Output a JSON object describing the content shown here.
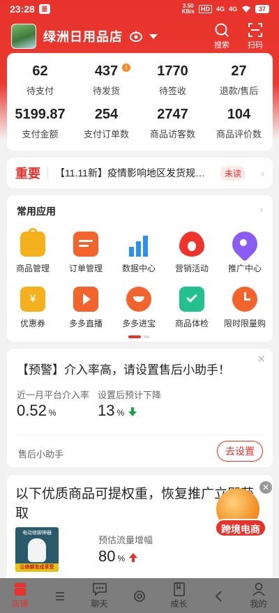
{
  "status_bar": {
    "time": "23:28",
    "app_badge": "鉴",
    "net_speed": "3.50",
    "net_unit": "KB/s",
    "hd": "HD",
    "sig1": "4G",
    "sig2": "4G",
    "battery": "37"
  },
  "header": {
    "shop_name": "绿洲日用品店",
    "search_label": "搜索",
    "scan_label": "扫码"
  },
  "stats": [
    {
      "value": "62",
      "label": "待支付"
    },
    {
      "value": "437",
      "label": "待发货",
      "badge": "!"
    },
    {
      "value": "1770",
      "label": "待签收"
    },
    {
      "value": "27",
      "label": "退款/售后"
    },
    {
      "value": "5199.87",
      "label": "支付金额"
    },
    {
      "value": "254",
      "label": "支付订单数"
    },
    {
      "value": "2747",
      "label": "商品访客数"
    },
    {
      "value": "104",
      "label": "商品评价数"
    }
  ],
  "notice": {
    "tag": "重要",
    "text": "【11.11新】疫情影响地区发货规…",
    "unread": "未读"
  },
  "apps": {
    "title": "常用应用",
    "items": [
      {
        "label": "商品管理",
        "color": "#f5b11d"
      },
      {
        "label": "订单管理",
        "color": "#f2642b"
      },
      {
        "label": "数据中心",
        "color": "#2f8ff0"
      },
      {
        "label": "营销活动",
        "color": "#f0342b"
      },
      {
        "label": "推广中心",
        "color": "#8a5cf5"
      },
      {
        "label": "优惠券",
        "color": "#f5b11d"
      },
      {
        "label": "多多直播",
        "color": "#f2642b"
      },
      {
        "label": "多多进宝",
        "color": "#f2642b"
      },
      {
        "label": "商品体检",
        "color": "#22c18d"
      },
      {
        "label": "限时限量购",
        "color": "#f2642b"
      }
    ]
  },
  "alert": {
    "title": "【预警】介入率高，请设置售后小助手！",
    "metric1_label": "近一月平台介入率",
    "metric1_value": "0.52",
    "metric1_unit": "%",
    "metric2_label": "设置后预计下降",
    "metric2_value": "13",
    "metric2_unit": "%",
    "footer": "售后小助手",
    "button": "去设置"
  },
  "promo": {
    "title": "以下优质商品可提权重，恢复推广立即获取",
    "product_caption": "电动修脚神器",
    "product_band": "让修脚变成享受",
    "metric_label": "预估流量增幅",
    "metric_value": "80",
    "metric_unit": "%"
  },
  "float_badge": {
    "label": "跨境电商"
  },
  "tabbar": [
    {
      "label": "店铺",
      "icon": "shop-icon",
      "active": true
    },
    {
      "label": "",
      "icon": "menu-icon"
    },
    {
      "label": "聊天",
      "icon": "chat-icon"
    },
    {
      "label": "",
      "icon": "home-circle-icon"
    },
    {
      "label": "成长",
      "icon": "book-icon"
    },
    {
      "label": "",
      "icon": "back-icon"
    },
    {
      "label": "我的",
      "icon": "person-icon"
    }
  ],
  "colors": {
    "brand": "#e7332b",
    "up": "#e7332b",
    "down": "#18a34a"
  }
}
